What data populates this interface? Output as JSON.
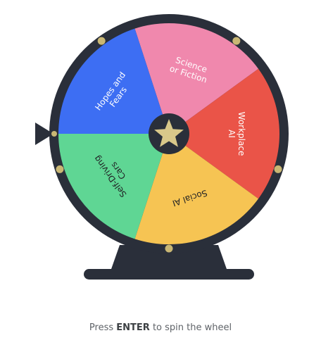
{
  "wheel": {
    "segments": [
      {
        "label_lines": [
          "Science",
          "or Fiction"
        ],
        "color": "#f088ad"
      },
      {
        "label_lines": [
          "Workplace",
          "AI"
        ],
        "color": "#ea5448"
      },
      {
        "label_lines": [
          "Social AI"
        ],
        "color": "#f6c453"
      },
      {
        "label_lines": [
          "Self-Driving",
          "Cars"
        ],
        "color": "#5fd694"
      },
      {
        "label_lines": [
          "Hopes and",
          "Fears"
        ],
        "color": "#3d6ef3"
      }
    ],
    "label_color": "#ffffff",
    "label_color_on_light": "#202124",
    "rim_color": "#2a2f3a",
    "peg_color": "#c9b774",
    "hub_color": "#2a2f3a",
    "star_color": "#d9c88a",
    "center_icon": "star-icon",
    "pointer_icon": "triangle-pointer-icon"
  },
  "hint": {
    "prefix": "Press",
    "key": "ENTER",
    "suffix": "to spin the wheel"
  }
}
